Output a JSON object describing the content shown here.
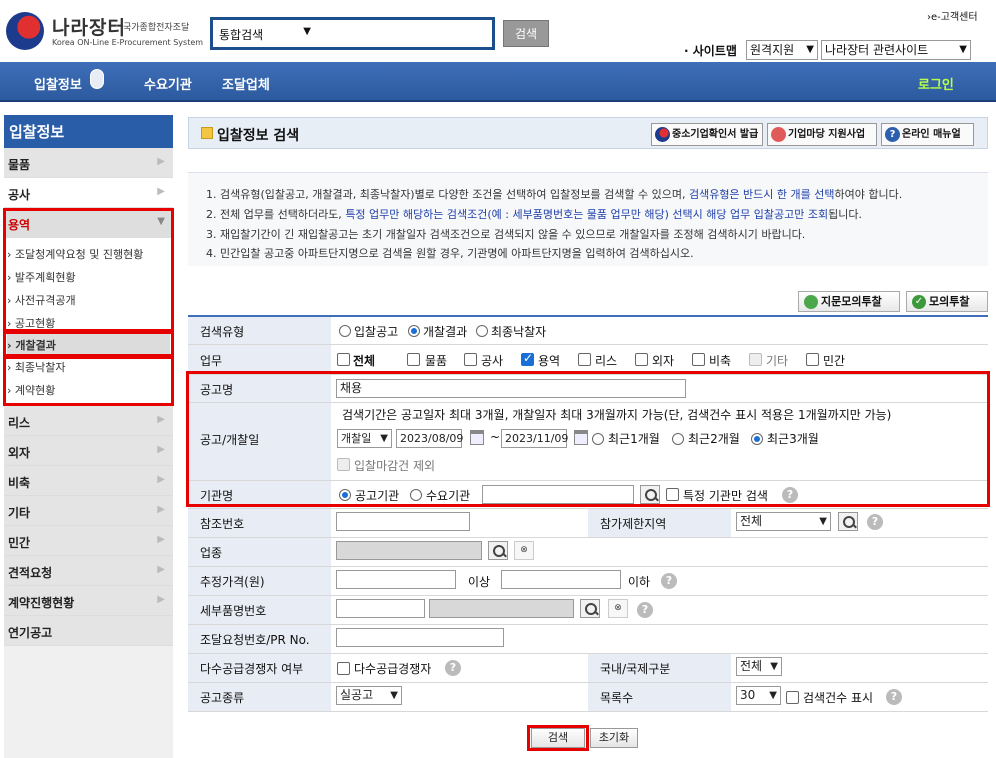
{
  "header": {
    "logo_title": "나라장터",
    "logo_sub1": "국가종합전자조달",
    "logo_sub2": "Korea ON-Line E-Procurement System",
    "search_scope": "통합검색",
    "search_button": "검색",
    "customer_center": "›e-고객센터",
    "sitemap": "· 사이트맵",
    "remote_support": "원격지원",
    "related_sites": "나라장터 관련사이트"
  },
  "gnb": {
    "items": [
      "입찰정보",
      "수요기관",
      "조달업체"
    ],
    "login": "로그인"
  },
  "sidebar": {
    "title": "입찰정보",
    "menus": [
      "물품",
      "공사",
      "용역",
      "리스",
      "외자",
      "비축",
      "기타",
      "민간",
      "견적요청",
      "계약진행현황",
      "연기공고"
    ],
    "submenus": [
      "조달청계약요청 및 진행현황",
      "발주계획현황",
      "사전규격공개",
      "공고현황",
      "개찰결과",
      "최종낙찰자",
      "계약현황"
    ]
  },
  "title_bar": {
    "title": "입찰정보 검색",
    "btn_sme": "중소기업확인서 발급",
    "btn_market": "기업마당 지원사업",
    "btn_manual": "온라인 매뉴얼"
  },
  "guide": {
    "line1_a": "1. 검색유형(입찰공고, 개찰결과, 최종낙찰자)별로 다양한 조건을 선택하여 입찰정보를 검색할 수 있으며, ",
    "line1_b": "검색유형은 반드시 한 개를 선택",
    "line1_c": "하여야 합니다.",
    "line2_a": "2. 전체 업무를 선택하더라도, ",
    "line2_b": "특정 업무만 해당하는 검색조건(예 : 세부품명번호는 물품 업무만 해당) 선택시 해당 업무 입찰공고만 조회",
    "line2_c": "됩니다.",
    "line3": "3. 재입찰기간이 긴 재입찰공고는 초기 개찰일자 검색조건으로 검색되지 않을 수 있으므로 개찰일자를 조정해 검색하시기 바랍니다.",
    "line4": "4. 민간입찰 공고중 아파트단지명으로 검색을 원할 경우, 기관명에 아파트단지명을 입력하여 검색하십시오."
  },
  "action_buttons": {
    "fingerprint": "지문모의투찰",
    "mock": "모의투찰"
  },
  "form": {
    "search_type_label": "검색유형",
    "search_types": [
      "입찰공고",
      "개찰결과",
      "최종낙찰자"
    ],
    "search_type_selected": "개찰결과",
    "work_label": "업무",
    "works": [
      "전체",
      "물품",
      "공사",
      "용역",
      "리스",
      "외자",
      "비축",
      "기타",
      "민간"
    ],
    "work_checked": "용역",
    "notice_name_label": "공고명",
    "notice_name_value": "채용",
    "date_label": "공고/개찰일",
    "date_note": "검색기간은 공고일자 최대 3개월, 개찰일자 최대 3개월까지 가능(단, 검색건수 표시 적용은 1개월까지만 가능)",
    "date_type": "개찰일",
    "date_from": "2023/08/09",
    "date_tilde": "~",
    "date_to": "2023/11/09",
    "period_options": [
      "최근1개월",
      "최근2개월",
      "최근3개월"
    ],
    "period_selected": "최근3개월",
    "exclude_closed": "입찰마감건 제외",
    "org_label": "기관명",
    "org_options": [
      "공고기관",
      "수요기관"
    ],
    "org_selected": "공고기관",
    "org_only": "특정 기관만 검색",
    "ref_label": "참조번호",
    "region_label": "참가제한지역",
    "region_value": "전체",
    "industry_label": "업종",
    "price_label": "추정가격(원)",
    "price_over": "이상",
    "price_under": "이하",
    "detail_label": "세부품명번호",
    "req_label": "조달요청번호/PR No.",
    "multi_label": "다수공급경쟁자 여부",
    "multi_option": "다수공급경쟁자",
    "intl_label": "국내/국제구분",
    "intl_value": "전체",
    "notice_type_label": "공고종류",
    "notice_type_value": "실공고",
    "count_label": "목록수",
    "count_value": "30",
    "show_count": "검색건수 표시"
  },
  "bottom": {
    "search": "검색",
    "reset": "초기화"
  }
}
